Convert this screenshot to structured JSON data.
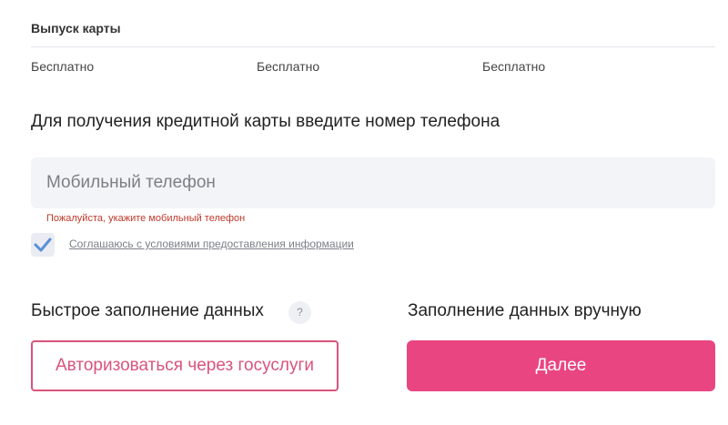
{
  "card_issue": {
    "title": "Выпуск карты",
    "values": [
      "Бесплатно",
      "Бесплатно",
      "Бесплатно"
    ]
  },
  "form": {
    "instruction": "Для получения кредитной карты введите номер телефона",
    "phone_placeholder": "Мобильный телефон",
    "phone_value": "",
    "error": "Пожалуйста, укажите мобильный телефон",
    "consent_label": "Соглашаюсь с условиями предоставления информации",
    "consent_checked": true
  },
  "actions": {
    "fast_fill_title": "Быстрое заполнение данных",
    "help_label": "?",
    "manual_fill_title": "Заполнение данных вручную",
    "gosuslugi_label": "Авторизоваться через госуслуги",
    "next_label": "Далее"
  },
  "colors": {
    "accent": "#e94581",
    "accent_outline": "#d9547d",
    "error": "#c0392b",
    "checkmark": "#5a8fd8",
    "input_bg": "#f2f4f7"
  },
  "icons": {
    "checkbox": "checkmark-icon",
    "help": "question-icon"
  }
}
